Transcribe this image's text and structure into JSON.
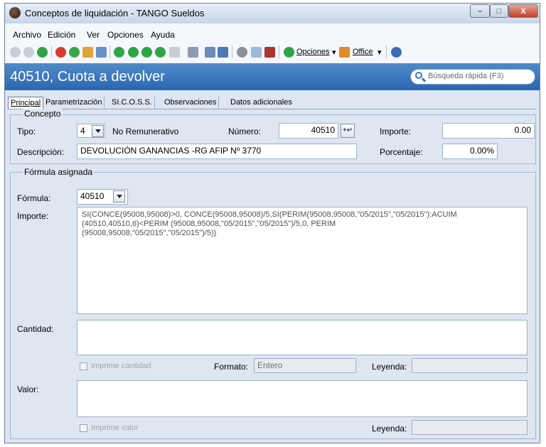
{
  "window": {
    "title": "Conceptos de liquidación - TANGO Sueldos",
    "min": "–",
    "max": "□",
    "close": "X"
  },
  "menu": {
    "items": [
      "Archivo",
      "Edición",
      "Ver",
      "Opciones",
      "Ayuda"
    ]
  },
  "toolbar": {
    "opciones_label": "Opciones",
    "office_label": "Office"
  },
  "header": {
    "title": "40510, Cuota a devolver",
    "search_placeholder": "Búsqueda rápida (F3)"
  },
  "tabs": [
    "Principal",
    "Parametrización",
    "SI.C.O.S.S.",
    "Observaciones",
    "Datos adicionales"
  ],
  "concepto": {
    "group_title": "Concepto",
    "tipo_label": "Tipo:",
    "tipo_value": "4",
    "tipo_desc": "No Remunerativo",
    "numero_label": "Número:",
    "numero_value": "40510",
    "importe_label": "Importe:",
    "importe_value": "0.00",
    "descripcion_label": "Descripción:",
    "descripcion_value": "DEVOLUCIÓN GANANCIAS -RG AFIP Nº 3770",
    "porcentaje_label": "Porcentaje:",
    "porcentaje_value": "0.00%"
  },
  "formula": {
    "group_title": "Fórmula asignada",
    "formula_label": "Fórmula:",
    "formula_value": "40510",
    "importe_label": "Importe:",
    "importe_text": "SI(CONCE(95008,95008)>0, CONCE(95008,95008)/5,SI(PERIM(95008,95008,\"05/2015\",\"05/2015\"):ACUIM\n(40510,40510,6)<PERIM (95008,95008,\"05/2015\",\"05/2015\")/5,0, PERIM\n(95008,95008,\"05/2015\",\"05/2015\")/5))",
    "cantidad_label": "Cantidad:",
    "cantidad_text": "",
    "imprime_cantidad_label": "Imprime cantidad",
    "formato_label": "Formato:",
    "formato_value": "Entero",
    "leyenda_label": "Leyenda:",
    "leyenda_value": "",
    "valor_label": "Valor:",
    "valor_text": "",
    "imprime_valor_label": "Imprime valor",
    "leyenda2_label": "Leyenda:",
    "leyenda2_value": ""
  },
  "colors": {
    "header_bg": "#2a67b0",
    "panel_bg": "#dde6f1"
  }
}
